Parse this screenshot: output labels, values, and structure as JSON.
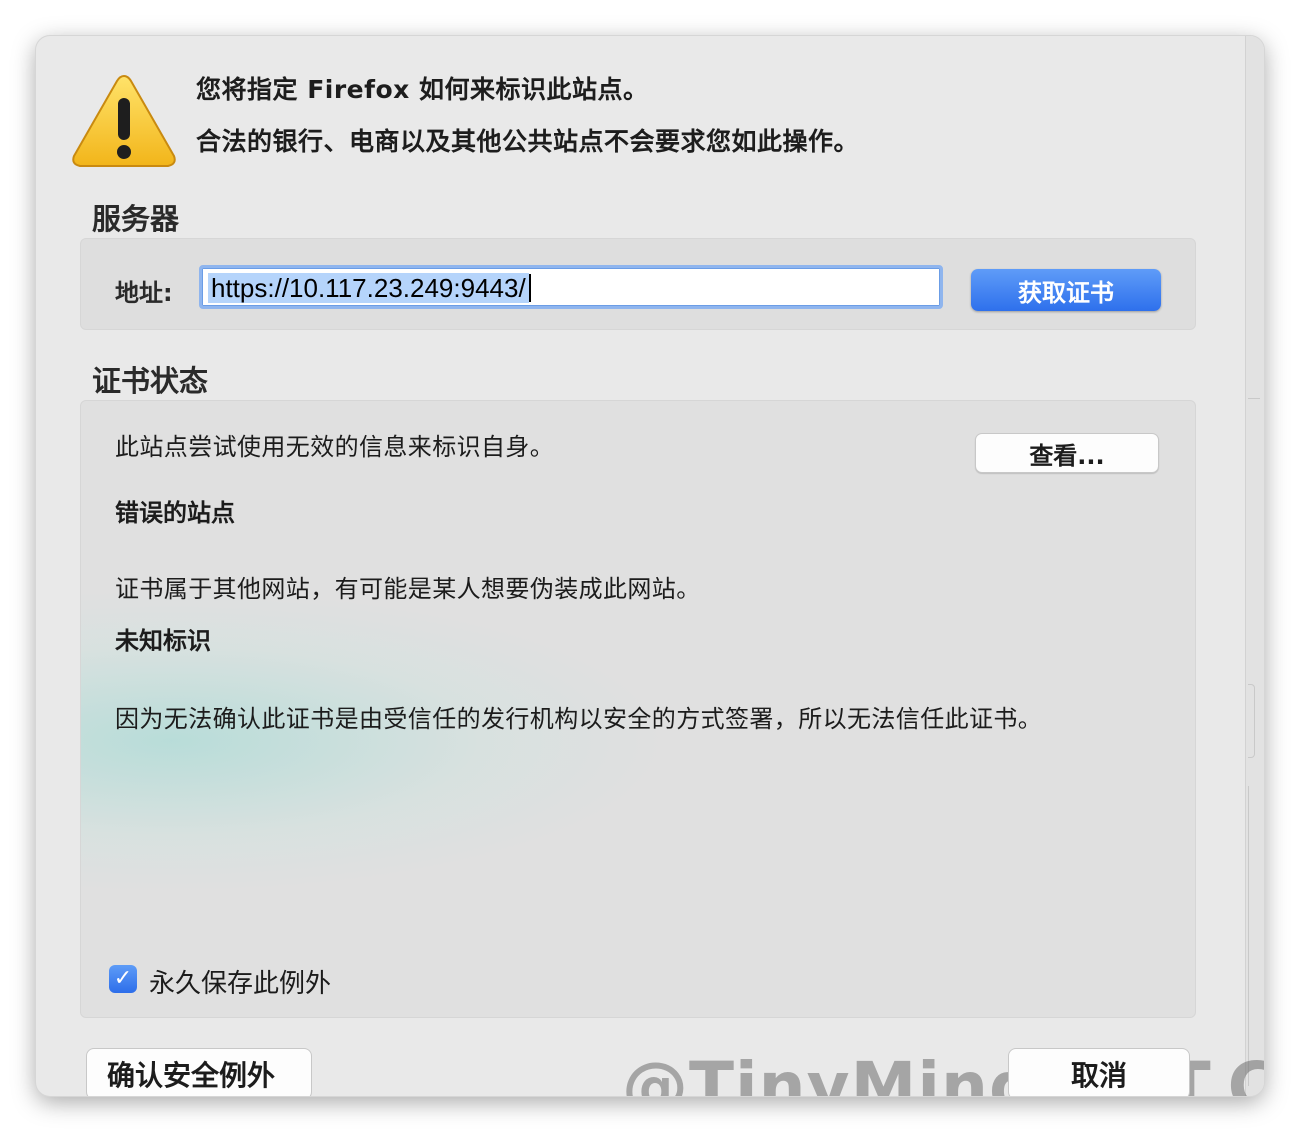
{
  "header": {
    "line1": "您将指定 Firefox 如何来标识此站点。",
    "line2": "合法的银行、电商以及其他公共站点不会要求您如此操作。",
    "icon": "warning-triangle-icon"
  },
  "server": {
    "section_title": "服务器",
    "address_label": "地址:",
    "address_value": "https://10.117.23.249:9443/",
    "fetch_button": "获取证书"
  },
  "status": {
    "section_title": "证书状态",
    "message": "此站点尝试使用无效的信息来标识自身。",
    "view_button": "查看...",
    "wrong_site_title": "错误的站点",
    "wrong_site_text": "证书属于其他网站，有可能是某人想要伪装成此网站。",
    "unknown_id_title": "未知标识",
    "unknown_id_text": "因为无法确认此证书是由受信任的发行机构以安全的方式签署，所以无法信任此证书。",
    "permanent_checkbox": {
      "label": "永久保存此例外",
      "checked": true
    }
  },
  "footer": {
    "confirm_button": "确认安全例外",
    "cancel_button": "取消",
    "watermark": "@TinyMind.NET.CN"
  },
  "colors": {
    "accent_blue": "#2e70ec",
    "selection": "#b5d4fb",
    "dialog_bg": "#e9e9e9"
  }
}
